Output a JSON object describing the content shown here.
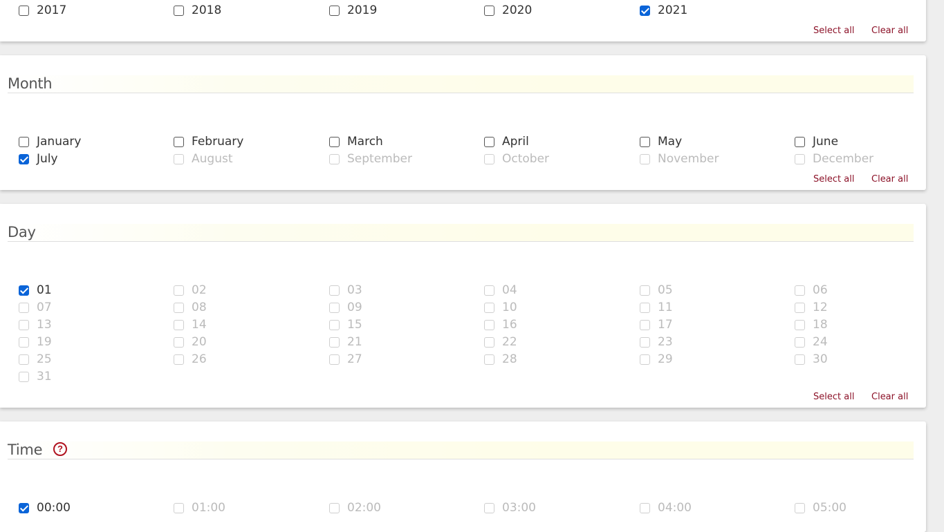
{
  "year_section": {
    "options": [
      {
        "label": "2017",
        "checked": false,
        "disabled": false
      },
      {
        "label": "2018",
        "checked": false,
        "disabled": false
      },
      {
        "label": "2019",
        "checked": false,
        "disabled": false
      },
      {
        "label": "2020",
        "checked": false,
        "disabled": false
      },
      {
        "label": "2021",
        "checked": true,
        "disabled": false
      }
    ],
    "select_all": "Select all",
    "clear_all": "Clear all"
  },
  "month_section": {
    "title": "Month",
    "options": [
      {
        "label": "January",
        "checked": false,
        "disabled": false
      },
      {
        "label": "February",
        "checked": false,
        "disabled": false
      },
      {
        "label": "March",
        "checked": false,
        "disabled": false
      },
      {
        "label": "April",
        "checked": false,
        "disabled": false
      },
      {
        "label": "May",
        "checked": false,
        "disabled": false
      },
      {
        "label": "June",
        "checked": false,
        "disabled": false
      },
      {
        "label": "July",
        "checked": true,
        "disabled": false
      },
      {
        "label": "August",
        "checked": false,
        "disabled": true
      },
      {
        "label": "September",
        "checked": false,
        "disabled": true
      },
      {
        "label": "October",
        "checked": false,
        "disabled": true
      },
      {
        "label": "November",
        "checked": false,
        "disabled": true
      },
      {
        "label": "December",
        "checked": false,
        "disabled": true
      }
    ],
    "select_all": "Select all",
    "clear_all": "Clear all"
  },
  "day_section": {
    "title": "Day",
    "options": [
      {
        "label": "01",
        "checked": true,
        "disabled": false
      },
      {
        "label": "02",
        "checked": false,
        "disabled": true
      },
      {
        "label": "03",
        "checked": false,
        "disabled": true
      },
      {
        "label": "04",
        "checked": false,
        "disabled": true
      },
      {
        "label": "05",
        "checked": false,
        "disabled": true
      },
      {
        "label": "06",
        "checked": false,
        "disabled": true
      },
      {
        "label": "07",
        "checked": false,
        "disabled": true
      },
      {
        "label": "08",
        "checked": false,
        "disabled": true
      },
      {
        "label": "09",
        "checked": false,
        "disabled": true
      },
      {
        "label": "10",
        "checked": false,
        "disabled": true
      },
      {
        "label": "11",
        "checked": false,
        "disabled": true
      },
      {
        "label": "12",
        "checked": false,
        "disabled": true
      },
      {
        "label": "13",
        "checked": false,
        "disabled": true
      },
      {
        "label": "14",
        "checked": false,
        "disabled": true
      },
      {
        "label": "15",
        "checked": false,
        "disabled": true
      },
      {
        "label": "16",
        "checked": false,
        "disabled": true
      },
      {
        "label": "17",
        "checked": false,
        "disabled": true
      },
      {
        "label": "18",
        "checked": false,
        "disabled": true
      },
      {
        "label": "19",
        "checked": false,
        "disabled": true
      },
      {
        "label": "20",
        "checked": false,
        "disabled": true
      },
      {
        "label": "21",
        "checked": false,
        "disabled": true
      },
      {
        "label": "22",
        "checked": false,
        "disabled": true
      },
      {
        "label": "23",
        "checked": false,
        "disabled": true
      },
      {
        "label": "24",
        "checked": false,
        "disabled": true
      },
      {
        "label": "25",
        "checked": false,
        "disabled": true
      },
      {
        "label": "26",
        "checked": false,
        "disabled": true
      },
      {
        "label": "27",
        "checked": false,
        "disabled": true
      },
      {
        "label": "28",
        "checked": false,
        "disabled": true
      },
      {
        "label": "29",
        "checked": false,
        "disabled": true
      },
      {
        "label": "30",
        "checked": false,
        "disabled": true
      },
      {
        "label": "31",
        "checked": false,
        "disabled": true
      }
    ],
    "select_all": "Select all",
    "clear_all": "Clear all"
  },
  "time_section": {
    "title": "Time",
    "help_icon": "question-circle-icon",
    "help_glyph": "?",
    "options": [
      {
        "label": "00:00",
        "checked": true,
        "disabled": false
      },
      {
        "label": "01:00",
        "checked": false,
        "disabled": true
      },
      {
        "label": "02:00",
        "checked": false,
        "disabled": true
      },
      {
        "label": "03:00",
        "checked": false,
        "disabled": true
      },
      {
        "label": "04:00",
        "checked": false,
        "disabled": true
      },
      {
        "label": "05:00",
        "checked": false,
        "disabled": true
      }
    ]
  },
  "colors": {
    "checkbox_checked": "#0a64d8",
    "link": "#8c1228",
    "help_icon": "#b0121f",
    "disabled_text": "#bbbbbb"
  }
}
